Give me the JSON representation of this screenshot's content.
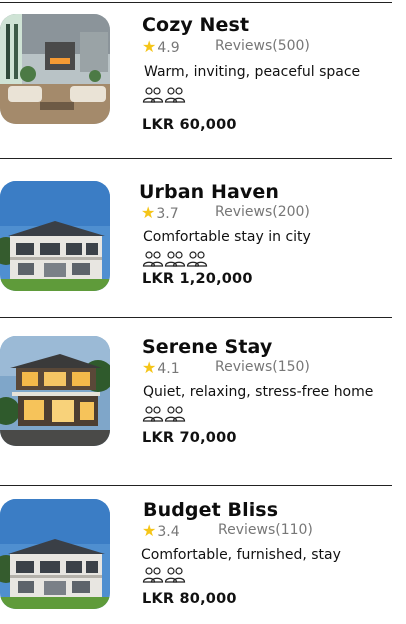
{
  "listings": [
    {
      "title": "Cozy Nest",
      "rating": "4.9",
      "reviews": "Reviews(500)",
      "description": "Warm, inviting, peaceful space",
      "guest_icons": [
        "guests-icon",
        "guests-icon"
      ],
      "price": "LKR 60,000",
      "image": "living-room-photo"
    },
    {
      "title": "Urban Haven",
      "rating": "3.7",
      "reviews": "Reviews(200)",
      "description": "Comfortable stay in city",
      "guest_icons": [
        "guests-icon",
        "guests-icon",
        "guests-icon"
      ],
      "price": "LKR 1,20,000",
      "image": "house-exterior-photo"
    },
    {
      "title": "Serene Stay",
      "rating": "4.1",
      "reviews": "Reviews(150)",
      "description": "Quiet, relaxing, stress-free home",
      "guest_icons": [
        "guests-icon",
        "guests-icon"
      ],
      "price": "LKR 70,000",
      "image": "modern-villa-photo"
    },
    {
      "title": "Budget Bliss",
      "rating": "3.4",
      "reviews": "Reviews(110)",
      "description": "Comfortable, furnished, stay",
      "guest_icons": [
        "guests-icon",
        "guests-icon"
      ],
      "price": "LKR 80,000",
      "image": "house-exterior-photo"
    }
  ],
  "colors": {
    "star": "#f5c518",
    "divider": "#222222",
    "muted_text": "#777777"
  },
  "icons": {
    "rating": "star-icon",
    "guests": "guests-icon"
  }
}
